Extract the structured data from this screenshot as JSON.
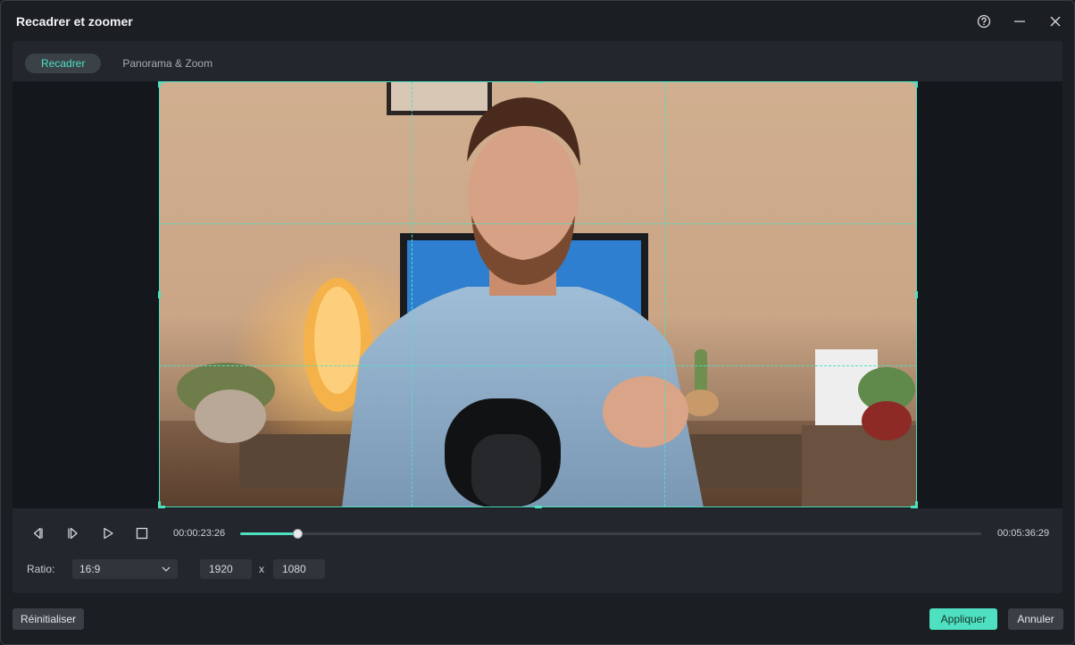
{
  "window": {
    "title": "Recadrer et zoomer"
  },
  "tabs": [
    {
      "label": "Recadrer",
      "active": true
    },
    {
      "label": "Panorama & Zoom",
      "active": false
    }
  ],
  "playback": {
    "current_time": "00:00:23:26",
    "total_time": "00:05:36:29",
    "progress": 0.077
  },
  "ratio": {
    "label": "Ratio:",
    "selected": "16:9",
    "width": "1920",
    "separator": "x",
    "height": "1080"
  },
  "footer": {
    "reset_label": "Réinitialiser",
    "apply_label": "Appliquer",
    "cancel_label": "Annuler"
  },
  "colors": {
    "accent": "#4ee0c1",
    "background": "#1b1e22",
    "panel": "#23272d"
  },
  "icons": [
    "help-icon",
    "minimize-icon",
    "close-icon",
    "prev-frame-icon",
    "next-frame-icon",
    "play-icon",
    "stop-icon",
    "chevron-down-icon"
  ]
}
